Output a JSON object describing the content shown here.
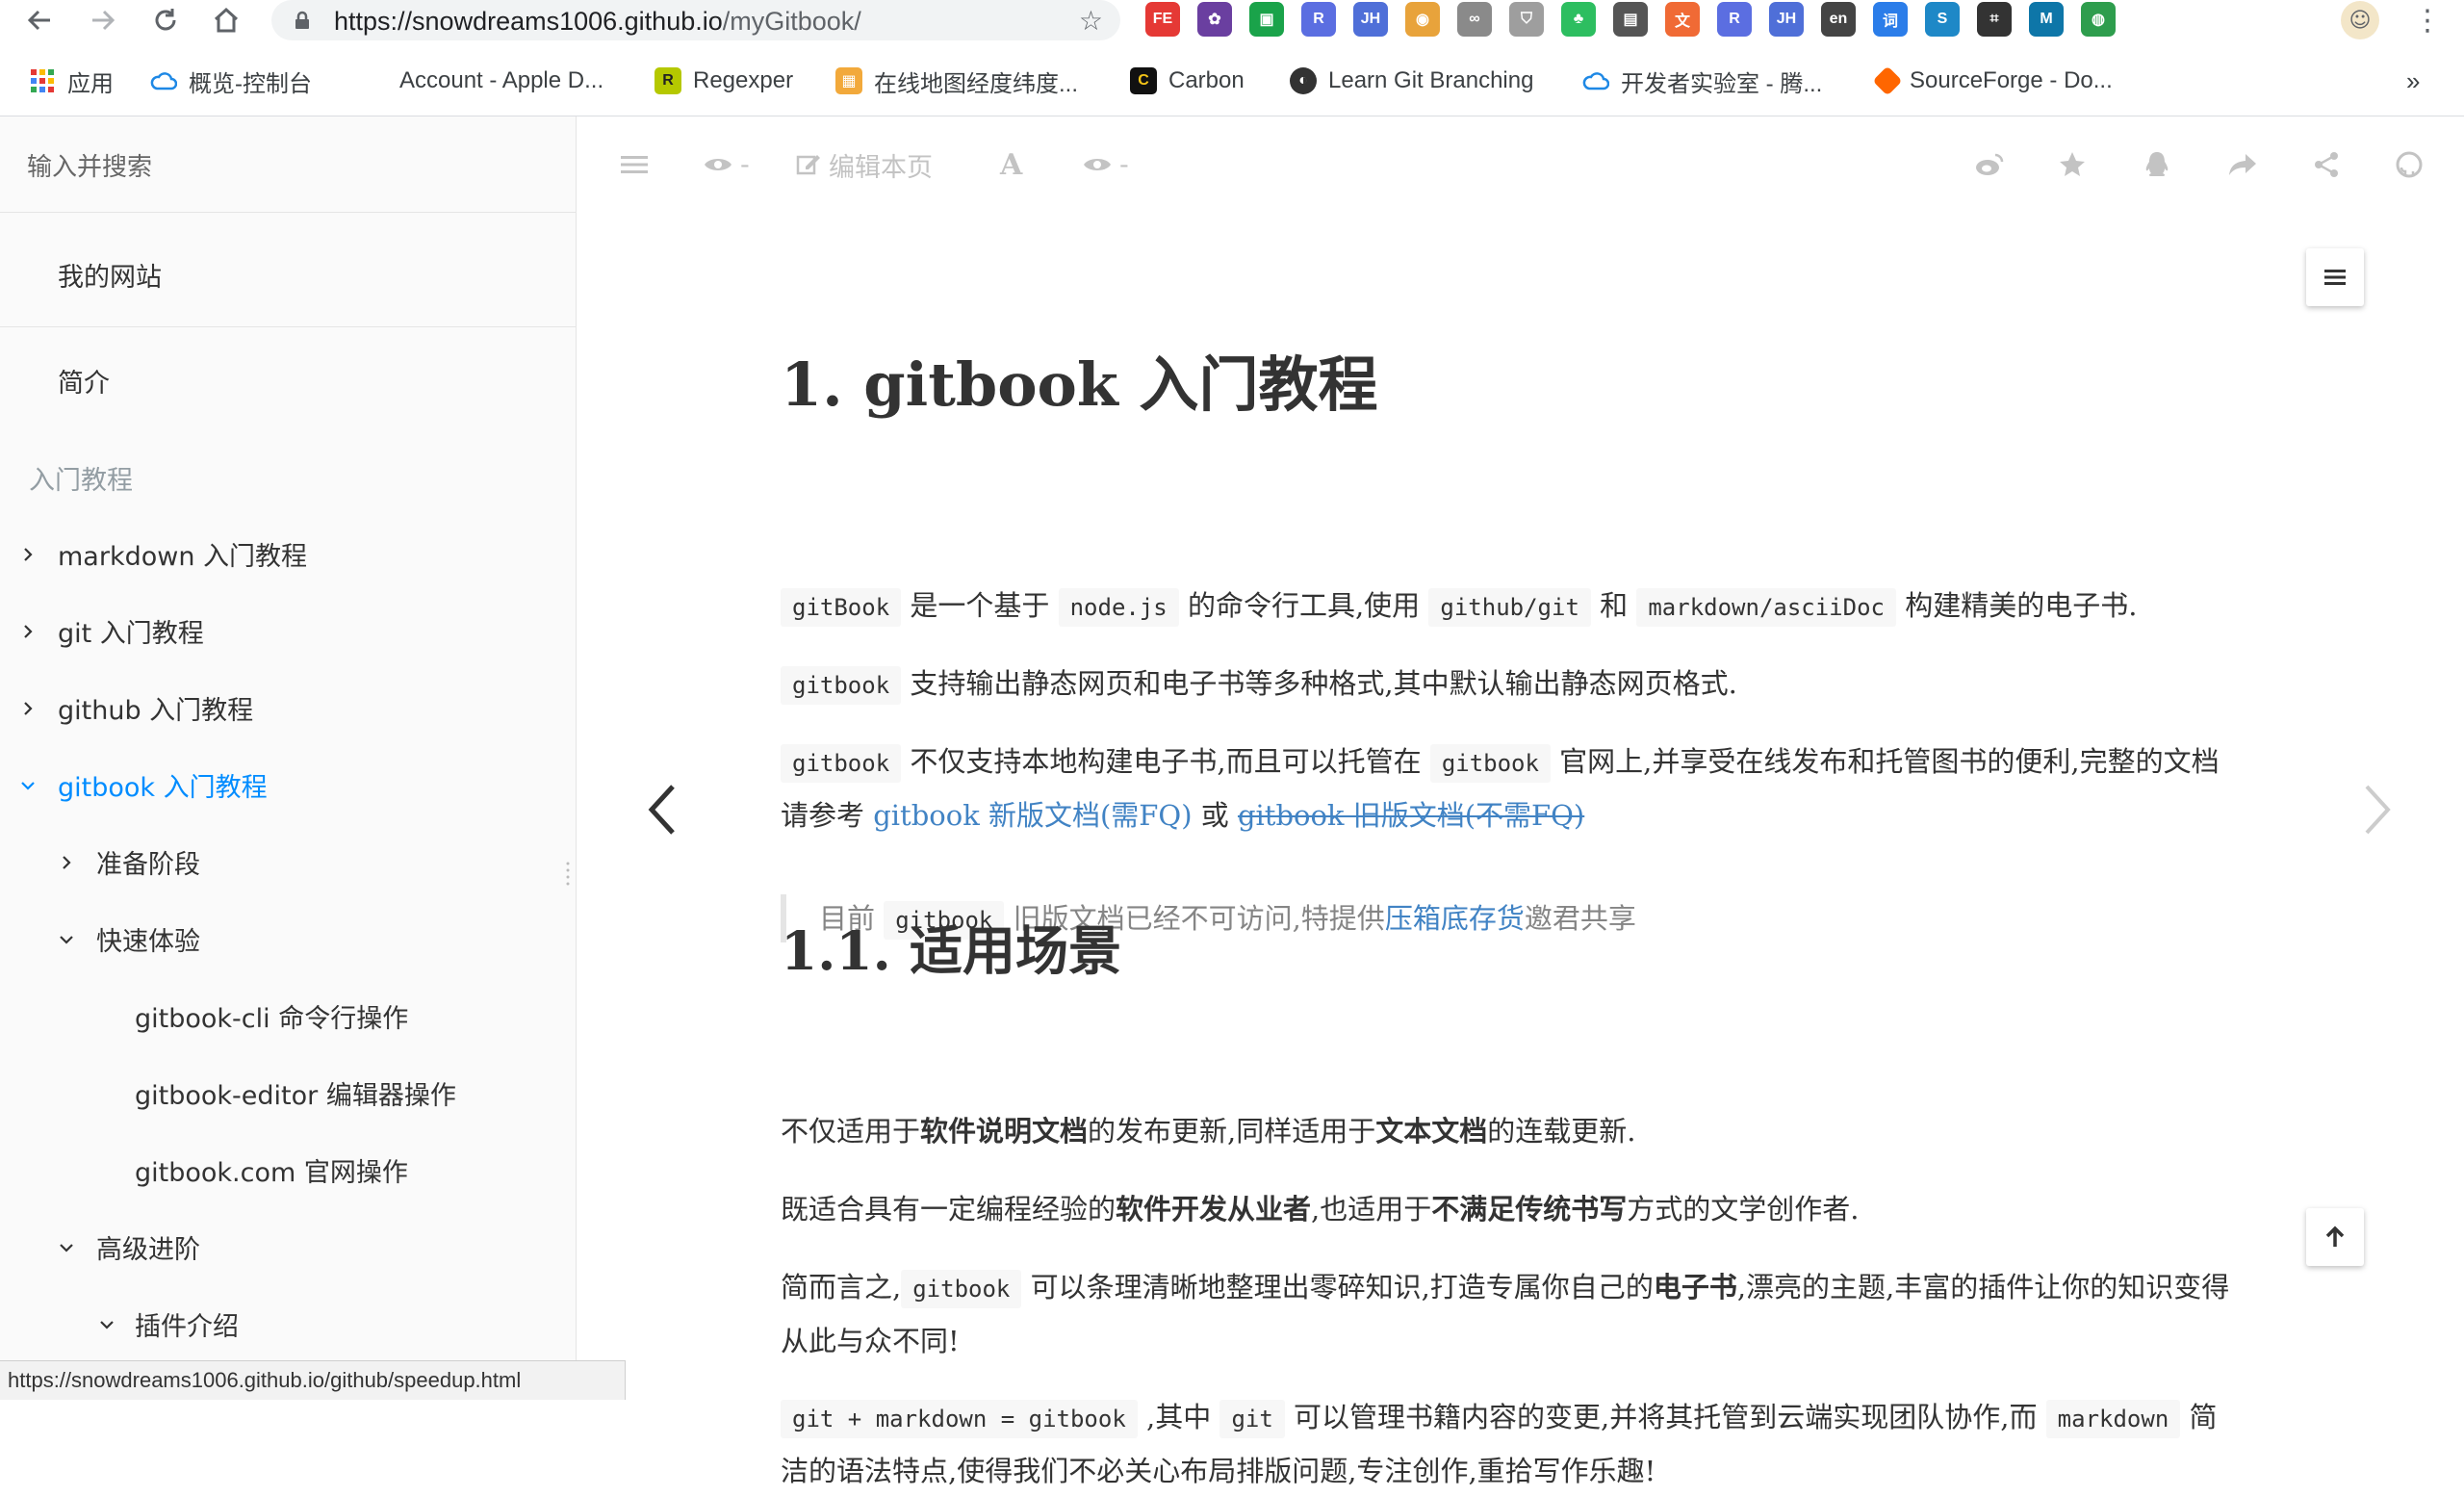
{
  "browser": {
    "url_host": "https://snowdreams1006.github.io",
    "url_path": "/myGitbook/",
    "extensions": [
      {
        "name": "fe-helper-icon",
        "label": "FE",
        "color": "#e53935"
      },
      {
        "name": "extension-icon-2",
        "label": "✿",
        "color": "#6a3fa0"
      },
      {
        "name": "extension-icon-3",
        "label": "▣",
        "color": "#1aa34a"
      },
      {
        "name": "extension-icon-4",
        "label": "R",
        "color": "#5b6ee1"
      },
      {
        "name": "jh-extension-icon",
        "label": "JH",
        "color": "#4f6fd8"
      },
      {
        "name": "color-ring-icon",
        "label": "◉",
        "color": "#e8a33b"
      },
      {
        "name": "infinity-icon",
        "label": "∞",
        "color": "#8a8a8a"
      },
      {
        "name": "shield-extension-icon",
        "label": "⛉",
        "color": "#9e9e9e"
      },
      {
        "name": "evernote-icon",
        "label": "♣",
        "color": "#2dbe60"
      },
      {
        "name": "book-extension-icon",
        "label": "▤",
        "color": "#555555"
      },
      {
        "name": "translate-extension-icon",
        "label": "文",
        "color": "#f06a35"
      },
      {
        "name": "extension-icon-r2",
        "label": "R",
        "color": "#5b6ee1"
      },
      {
        "name": "jh-extension-icon-2",
        "label": "JH",
        "color": "#4f6fd8"
      },
      {
        "name": "word-extension-icon",
        "label": "en",
        "color": "#444444"
      },
      {
        "name": "dict-extension-icon",
        "label": "词",
        "color": "#2b7de9"
      },
      {
        "name": "s-extension-icon",
        "label": "S",
        "color": "#1e88c7"
      },
      {
        "name": "screenshot-extension-icon",
        "label": "⌗",
        "color": "#333333"
      },
      {
        "name": "m-extension-icon",
        "label": "M",
        "color": "#0e76a8"
      },
      {
        "name": "globe-extension-icon",
        "label": "◍",
        "color": "#2e9d4d"
      }
    ],
    "bookmarks": {
      "apps": "应用",
      "b1": "概览-控制台",
      "b2": "Account - Apple D...",
      "b3": "Regexper",
      "b4": "在线地图经度纬度...",
      "b5": "Carbon",
      "b6": "Learn Git Branching",
      "b7": "开发者实验室 - 腾...",
      "b8": "SourceForge - Do...",
      "more": "»"
    },
    "status_url": "https://snowdreams1006.github.io/github/speedup.html"
  },
  "sidebar": {
    "search_placeholder": "输入并搜索",
    "my_site": "我的网站",
    "intro": "简介",
    "section_header": "入门教程",
    "items": {
      "markdown": "markdown 入门教程",
      "git": "git 入门教程",
      "github": "github 入门教程",
      "gitbook": "gitbook 入门教程",
      "prepare": "准备阶段",
      "quick": "快速体验",
      "cli": "gitbook-cli 命令行操作",
      "editor": "gitbook-editor 编辑器操作",
      "com": "gitbook.com 官网操作",
      "advanced": "高级进阶",
      "plugins": "插件介绍"
    }
  },
  "topbar": {
    "views1": "-",
    "edit": "编辑本页",
    "font": "A",
    "views2": "-"
  },
  "article": {
    "h1": "1. gitbook 入门教程",
    "p1": {
      "c1": "gitBook",
      "t1": " 是一个基于 ",
      "c2": "node.js",
      "t2": " 的命令行工具,使用 ",
      "c3": "github/git",
      "t3": " 和 ",
      "c4": "markdown/asciiDoc",
      "t4": " 构建精美的电子书."
    },
    "p2": {
      "c1": "gitbook",
      "t1": " 支持输出静态网页和电子书等多种格式,其中默认输出静态网页格式."
    },
    "p3": {
      "c1": "gitbook",
      "t1": " 不仅支持本地构建电子书,而且可以托管在 ",
      "c2": "gitbook",
      "t2": " 官网上,并享受在线发布和托管图书的便利,完整的文档请参考 ",
      "link1": "gitbook 新版文档(需FQ)",
      "t3": " 或 ",
      "link2": "gitbook 旧版文档(不需FQ)"
    },
    "quote": {
      "t1": "目前 ",
      "c1": "gitbook",
      "t2": " 旧版文档已经不可访问,特提供",
      "link": "压箱底存货",
      "t3": "邀君共享"
    },
    "h2": "1.1. 适用场景",
    "p4": {
      "t1": "不仅适用于",
      "b1": "软件说明文档",
      "t2": "的发布更新,同样适用于",
      "b2": "文本文档",
      "t3": "的连载更新."
    },
    "p5": {
      "t1": "既适合具有一定编程经验的",
      "b1": "软件开发从业者",
      "t2": ",也适用于",
      "b2": "不满足传统书写",
      "t3": "方式的文学创作者."
    },
    "p6": {
      "t1": "简而言之,",
      "c1": "gitbook",
      "t2": " 可以条理清晰地整理出零碎知识,打造专属你自己的",
      "b1": "电子书",
      "t3": ",漂亮的主题,丰富的插件让你的知识变得从此与众不同!"
    },
    "p7": {
      "c1": "git + markdown = gitbook",
      "t1": " ,其中 ",
      "c2": "git",
      "t2": " 可以管理书籍内容的变更,并将其托管到云端实现团队协作,而 ",
      "c3": "markdown",
      "t3": " 简洁的语法特点,使得我们不必关心布局排版问题,专注创作,重拾写作乐趣!"
    }
  }
}
